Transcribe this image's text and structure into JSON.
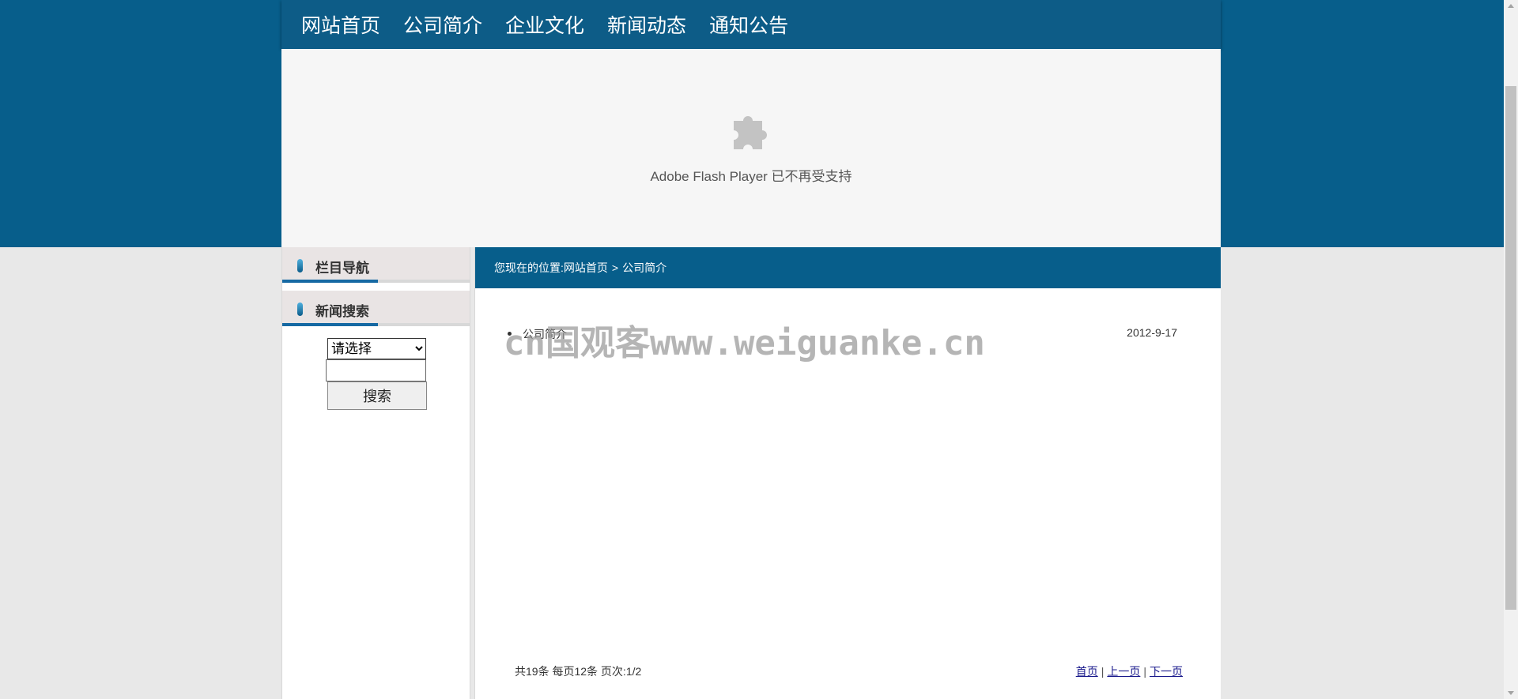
{
  "colors": {
    "primary_blue": "#075e8b",
    "nav_blue": "#0d5c87",
    "page_bg": "#e8e8e8"
  },
  "nav": {
    "items": [
      "网站首页",
      "公司简介",
      "企业文化",
      "新闻动态",
      "通知公告"
    ]
  },
  "flash": {
    "icon": "puzzle-piece-icon",
    "message": "Adobe Flash Player 已不再受支持"
  },
  "sidebar": {
    "column_nav_title": "栏目导航",
    "news_search_title": "新闻搜索",
    "search": {
      "select_value": "请选择",
      "input_value": "",
      "button_label": "搜索"
    }
  },
  "main": {
    "breadcrumb": {
      "prefix": "您现在的位置:",
      "home": "网站首页",
      "separator": ">",
      "current": "公司简介"
    },
    "list": [
      {
        "title": "公司简介",
        "date": "2012-9-17"
      }
    ],
    "watermark": "cn国观客www.weiguanke.cn",
    "pager": {
      "summary": "共19条 每页12条 页次:1/2",
      "first": "首页",
      "prev": "上一页",
      "next": "下一页",
      "divider": "|"
    }
  }
}
